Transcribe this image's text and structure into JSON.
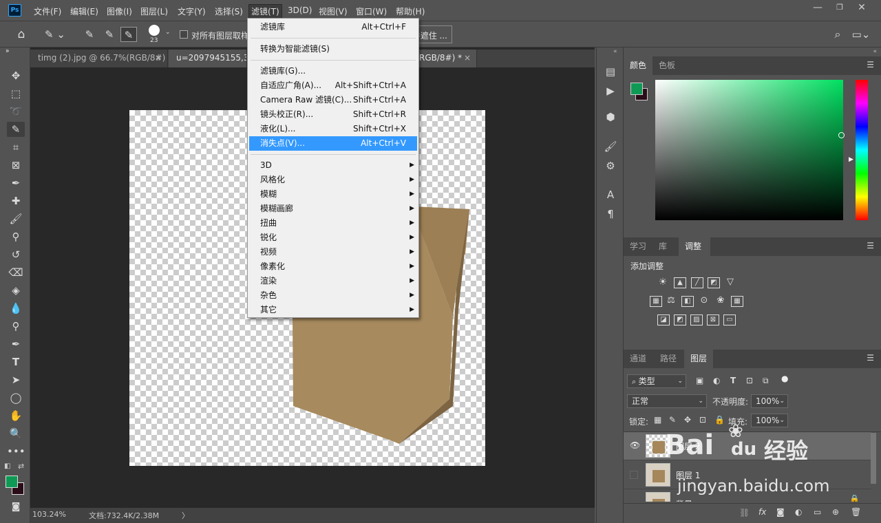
{
  "app": {
    "logo": "Ps"
  },
  "menubar": {
    "items": [
      "文件(F)",
      "编辑(E)",
      "图像(I)",
      "图层(L)",
      "文字(Y)",
      "选择(S)",
      "滤镜(T)",
      "3D(D)",
      "视图(V)",
      "窗口(W)",
      "帮助(H)"
    ]
  },
  "window_controls": {
    "minimize": "—",
    "restore": "❐",
    "close": "✕"
  },
  "options": {
    "brush_size": "23",
    "sample_all_layers": "对所有图层取样",
    "enhance_edge": "选择并遮住 ..."
  },
  "tabs": [
    {
      "label": "timg (2).jpg @ 66.7%(RGB/8#)",
      "close": "×"
    },
    {
      "label": "u=2097945155,37",
      "close": ""
    },
    {
      "label": "RGB/8#) *",
      "close": "×"
    }
  ],
  "filter_menu": {
    "items": [
      {
        "label": "滤镜库",
        "shortcut": "Alt+Ctrl+F"
      },
      {
        "label": "转换为智能滤镜(S)",
        "shortcut": ""
      },
      {
        "label": "滤镜库(G)...",
        "shortcut": ""
      },
      {
        "label": "自适应广角(A)...",
        "shortcut": "Alt+Shift+Ctrl+A"
      },
      {
        "label": "Camera Raw 滤镜(C)...",
        "shortcut": "Shift+Ctrl+A"
      },
      {
        "label": "镜头校正(R)...",
        "shortcut": "Shift+Ctrl+R"
      },
      {
        "label": "液化(L)...",
        "shortcut": "Shift+Ctrl+X"
      },
      {
        "label": "消失点(V)...",
        "shortcut": "Alt+Ctrl+V"
      },
      {
        "label": "3D"
      },
      {
        "label": "风格化"
      },
      {
        "label": "模糊"
      },
      {
        "label": "模糊画廊"
      },
      {
        "label": "扭曲"
      },
      {
        "label": "锐化"
      },
      {
        "label": "视频"
      },
      {
        "label": "像素化"
      },
      {
        "label": "渲染"
      },
      {
        "label": "杂色"
      },
      {
        "label": "其它"
      }
    ]
  },
  "status": {
    "zoom": "103.24%",
    "doc": "文档:732.4K/2.38M",
    "arrow": "〉"
  },
  "color_panel": {
    "tabs": [
      "颜色",
      "色板"
    ],
    "foreground": "#0e9a55",
    "background": "#2a0d18",
    "hue_color": "#00e060"
  },
  "adjust_panel": {
    "tabs": [
      "学习",
      "库",
      "调整"
    ],
    "title": "添加调整"
  },
  "layers_panel": {
    "tabs": [
      "通道",
      "路径",
      "图层"
    ],
    "filter_kind": "类型",
    "blend_mode": "正常",
    "opacity_label": "不透明度:",
    "opacity": "100%",
    "lock_label": "锁定:",
    "fill_label": "填充:",
    "fill": "100%",
    "layers": [
      {
        "name": "图层 2"
      },
      {
        "name": "图层 1"
      },
      {
        "name": "背景"
      }
    ]
  },
  "watermark": {
    "text1": "Bai",
    "text2": "du",
    "text3": "经验",
    "url": "jingyan.baidu.com"
  }
}
